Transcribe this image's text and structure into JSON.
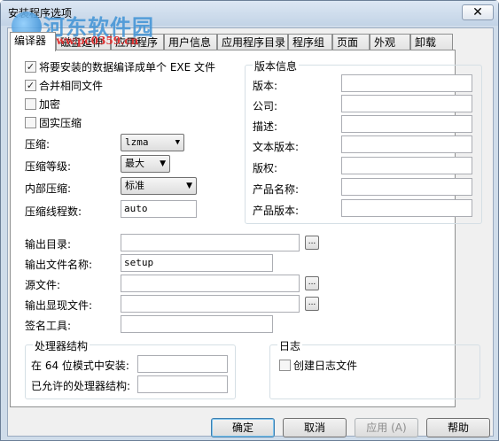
{
  "window": {
    "title": "安装程序选项",
    "close_glyph": "✕"
  },
  "watermark": {
    "name": "河东软件园",
    "url": "www.pc0359.cn"
  },
  "tabs": [
    "编译器",
    "磁盘延伸",
    "应用程序",
    "用户信息",
    "应用程序目录",
    "程序组",
    "页面",
    "外观",
    "卸载"
  ],
  "compile": {
    "checkboxes": [
      {
        "label": "将要安装的数据编译成单个 EXE 文件",
        "checked": true
      },
      {
        "label": "合并相同文件",
        "checked": true
      },
      {
        "label": "加密",
        "checked": false
      },
      {
        "label": "固实压缩",
        "checked": false
      }
    ],
    "compression_label": "压缩:",
    "compression_value": "lzma",
    "level_label": "压缩等级:",
    "level_value": "最大",
    "internal_label": "内部压缩:",
    "internal_value": "标准",
    "threads_label": "压缩线程数:",
    "threads_value": "auto"
  },
  "version_info": {
    "title": "版本信息",
    "fields": [
      {
        "label": "版本:",
        "value": ""
      },
      {
        "label": "公司:",
        "value": ""
      },
      {
        "label": "描述:",
        "value": ""
      },
      {
        "label": "文本版本:",
        "value": ""
      },
      {
        "label": "版权:",
        "value": ""
      },
      {
        "label": "产品名称:",
        "value": ""
      },
      {
        "label": "产品版本:",
        "value": ""
      }
    ]
  },
  "output": {
    "dir_label": "输出目录:",
    "dir_value": "",
    "filename_label": "输出文件名称:",
    "filename_value": "setup",
    "source_label": "源文件:",
    "source_value": "",
    "manifest_label": "输出显现文件:",
    "manifest_value": "",
    "sign_label": "签名工具:",
    "sign_value": "",
    "browse_glyph": "..."
  },
  "processor": {
    "title": "处理器结构",
    "x64_label": "在 64 位模式中安装:",
    "x64_value": "",
    "allowed_label": "已允许的处理器结构:",
    "allowed_value": ""
  },
  "log": {
    "title": "日志",
    "create_label": "创建日志文件",
    "checked": false
  },
  "buttons": {
    "ok": "确定",
    "cancel": "取消",
    "apply": "应用 (A)",
    "help": "帮助"
  }
}
